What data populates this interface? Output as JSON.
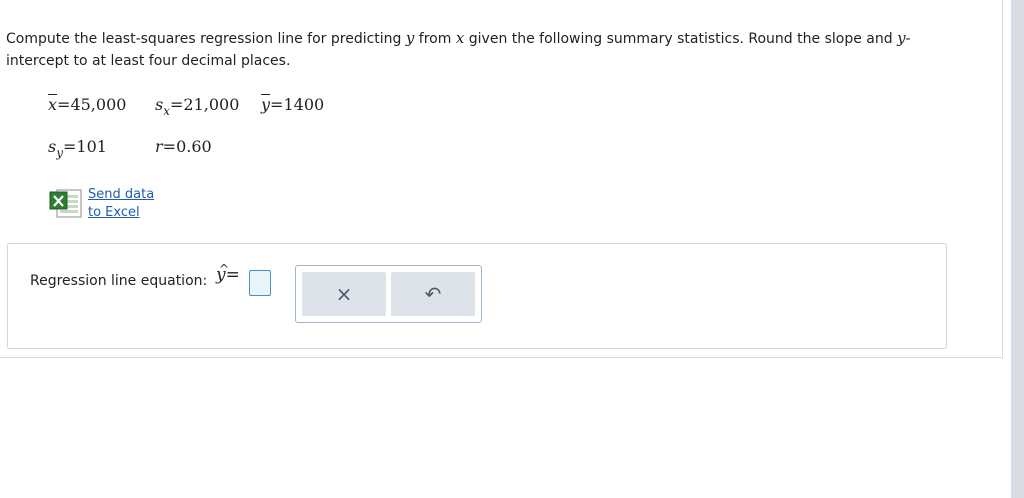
{
  "question": {
    "part1": "Compute the least-squares regression line for predicting ",
    "var_y": "y",
    "part2": " from ",
    "var_x": "x",
    "part3": " given the following summary statistics. Round the slope and ",
    "var_y2": "y",
    "part4": "-intercept to at least four decimal places."
  },
  "stats": {
    "xbar": {
      "symbol": "x",
      "value": "45,000"
    },
    "sx": {
      "symbol": "s",
      "sub": "x",
      "value": "21,000"
    },
    "ybar": {
      "symbol": "y",
      "value": "1400"
    },
    "sy": {
      "symbol": "s",
      "sub": "y",
      "value": "101"
    },
    "r": {
      "symbol": "r",
      "value": "0.60"
    }
  },
  "excel": {
    "link_line1": "Send data",
    "link_line2": "to Excel",
    "icon": "excel-icon"
  },
  "answer": {
    "label": "Regression line equation:",
    "lhs": "y",
    "hat": "^",
    "equals": "=",
    "input_value": ""
  },
  "tools": {
    "clear_icon": "×",
    "undo_icon": "↶"
  }
}
